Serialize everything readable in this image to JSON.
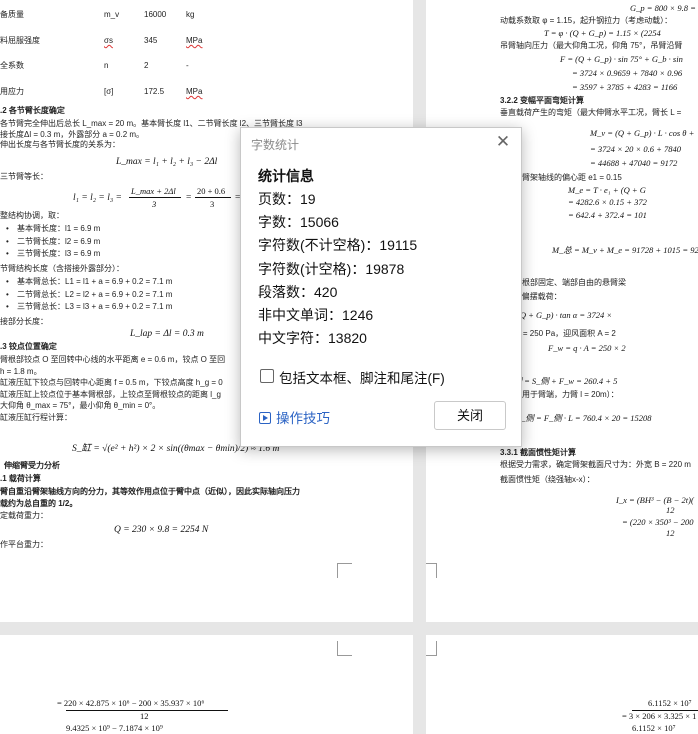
{
  "left_page": {
    "param_rows": [
      {
        "name": "备质量",
        "symbol": "m_v",
        "value": "16000",
        "unit": "kg"
      },
      {
        "name": "料屈服强度",
        "symbol": "σs",
        "value": "345",
        "unit": "MPa"
      },
      {
        "name": "全系数",
        "symbol": "n",
        "value": "2",
        "unit": "-"
      },
      {
        "name": "用应力",
        "symbol": "[σ]",
        "value": "172.5",
        "unit": "MPa"
      }
    ],
    "sec_a_heading": ".2 各节臂长度确定",
    "sec_a_lines": [
      "各节臂完全伸出后总长 L_max = 20 m。基本臂长度 l1、二节臂长度 l2、三节臂长度 l3",
      "接长度Δl = 0.3 m，外露部分 a = 0.2 m。",
      "伸出长度与各节臂长度的关系为："
    ],
    "eq1": "L_max = l₁ + l₂ + l₃ − 2Δl",
    "equal_len_label": "三节臂等长：",
    "eq2_lhs": "l₁ = l₂ = l₃ =",
    "eq2_num": "L_max + 2Δl",
    "eq2_den": "3",
    "eq2_num2": "20 + 0.6",
    "eq2_den2": "3",
    "eq2_result": "= 6.87",
    "coord_line": "整结构协调，取：",
    "len_items": [
      "基本臂长度：l1 = 6.9 m",
      "二节臂长度：l2 = 6.9 m",
      "三节臂长度：l3 = 6.9 m"
    ],
    "total_len_label": "节臂结构长度（含搭接外露部分）：",
    "total_items": [
      "基本臂总长：L1 = l1 + a = 6.9 + 0.2 = 7.1 m",
      "二节臂总长：L2 = l2 + a = 6.9 + 0.2 = 7.1 m",
      "三节臂总长：L3 = l3 + a = 6.9 + 0.2 = 7.1 m"
    ],
    "overlap_label": "接部分长度：",
    "eq3": "L_lap = Δl = 0.3 m",
    "sec_b_heading": ".3 铰点位置确定",
    "sec_b_lines": [
      "臂根部铰点 O 至回转中心线的水平距离  e = 0.6 m，铰点 O 至回",
      "h = 1.8 m。",
      "缸液压缸下铰点与回转中心距离  f = 0.5 m，下铰点高度 h_g = 0",
      "缸液压缸上铰点位于基本臂根部，上铰点至臂根铰点的距离 l_g",
      "大仰角 θ_max = 75°，最小仰角 θ_min = 0°。",
      "缸液压缸行程计算："
    ],
    "eq4": "S_缸 = √(e² + h²) × 2 × sin((θmax − θmin)/2) ≈ 1.6 m",
    "sec_c_heading": "伸缩臂受力分析",
    "sec_c_sub": ".1 载荷计算",
    "sec_c_lines": [
      "臂自重沿臂架轴线方向的分力，其等效作用点位于臂中点（近似），因此实际轴向压力",
      "载约为总自重的 1/2。",
      "定载荷重力："
    ],
    "eq5": "Q = 230 × 9.8 = 2254 N",
    "platform_label": "作平台重力："
  },
  "right_page": {
    "lines": [
      "G_p = 800 × 9.8 = 7",
      "动载系数取 φ = 1.15，起升钢拉力（考虑动载）：",
      "T = φ · (Q + G_p) = 1.15 × (2254",
      "吊臂轴向压力（最大仰角工况，仰角 75°，吊臂沿臂",
      "F = (Q + G_p) · sin 75° + G_b · sin",
      "= 3724 × 0.9659 + 7840 × 0.96",
      "= 3597 + 3785 + 4283 = 1166",
      "3.2.2 变幅平面弯矩计算",
      "垂直载荷产生的弯矩（最大伸臂水平工况，臂长 L =",
      "M_v = (Q + G_p) · L · cos θ +",
      "= 3724 × 20 × 0.6 + 7840",
      "= 44688 + 47040 = 9172",
      "弯矩（偏离测轮与臂架轴线的偏心距 e1 = 0.15",
      "M_e = T · e₁ + (Q + G",
      "= 4282.6 × 0.15 + 372",
      "= 642.4 + 372.4 = 101",
      "平面总弯矩：",
      "M_总 = M_v + M_e = 91728 + 1015 = 92",
      "旋转平面受力分析",
      "简在旋转平面视为根部固定、端部自由的悬臂梁",
      "偏摆角取 α = 4°，偏摆载荷：",
      "S_侧 = (Q + G_p) · tan α = 3724 ×",
      "荷（取基本风压 q = 250 Pa，迎风面积 A = 2",
      "F_w = q · A = 250 × 2",
      "平面侧向总载荷：",
      "F_侧 = S_侧 + F_w = 260.4 + 5",
      "平面弯矩（载荷作用于臂端，力臂 l = 20m）：",
      "M_侧 = F_侧 · L = 760.4 × 20 = 15208",
      "伸缩臂刚度校核",
      "3.3.1 截面惯性矩计算",
      "根据受力需求，确定臂架截面尺寸为：外宽 B = 220 m",
      "截面惯性矩（绕强轴x-x）：",
      "I_x = (BH³ − (B − 2t)(",
      "12",
      "= (220 × 350³ − 200",
      "12"
    ]
  },
  "bottom_left": {
    "eq_num": "= 220 × 42.875 × 10⁶ − 200 × 35.937 × 10⁶",
    "eq_den": "12",
    "eq_next": "9.4325 × 10⁹ − 7.1874 × 10⁹"
  },
  "bottom_right": {
    "eq_num": "6.1152 × 10⁷",
    "eq_den": "= 3 × 206 × 3.325 × 1",
    "eq_next": "6.1152 × 10⁷"
  },
  "dialog": {
    "title": "字数统计",
    "header": "统计信息",
    "stats": [
      {
        "label": "页数",
        "value": "19"
      },
      {
        "label": "字数",
        "value": "15066"
      },
      {
        "label": "字符数(不计空格)",
        "value": "19115"
      },
      {
        "label": "字符数(计空格)",
        "value": "19878"
      },
      {
        "label": "段落数",
        "value": "420"
      },
      {
        "label": "非中文单词",
        "value": "1246"
      },
      {
        "label": "中文字符",
        "value": "13820"
      }
    ],
    "checkbox_label": "包括文本框、脚注和尾注(F)",
    "checkbox_checked": false,
    "tips_label": "操作技巧",
    "close_label": "关闭"
  }
}
